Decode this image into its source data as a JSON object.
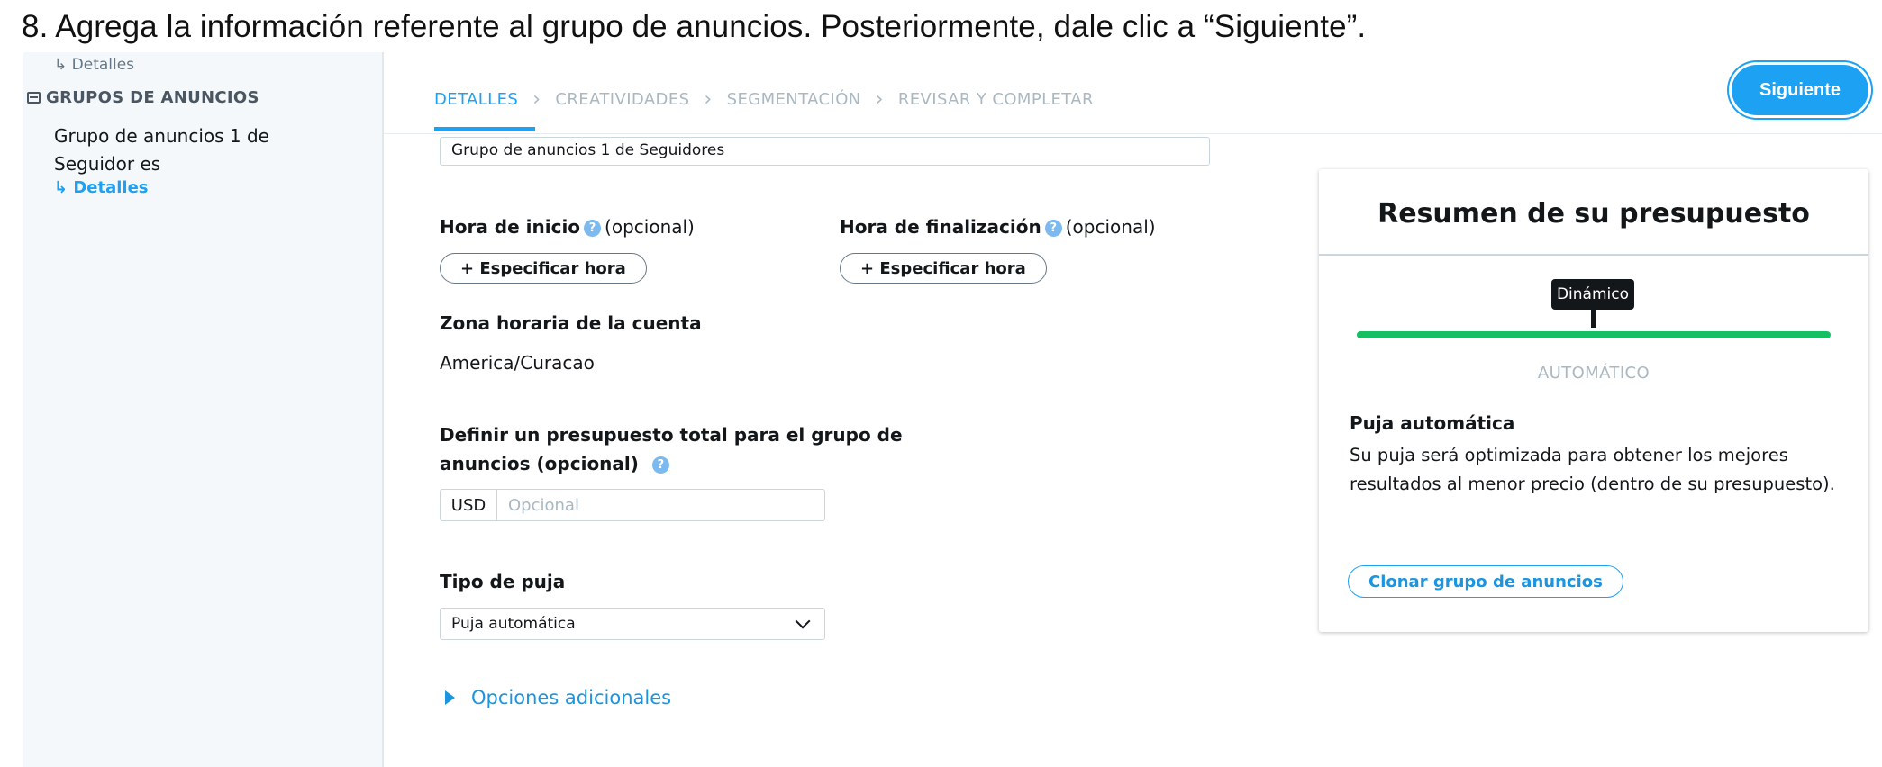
{
  "caption": "8. Agrega la información referente al grupo de anuncios. Posteriormente, dale clic a “Siguiente”.",
  "sidebar": {
    "top_sub": "↳ Detalles",
    "group_label": "GRUPOS DE ANUNCIOS",
    "item_label": "Grupo de anuncios 1 de Seguidor es",
    "active_sub": "↳ Detalles"
  },
  "tabs": [
    {
      "label": "DETALLES",
      "active": true
    },
    {
      "label": "CREATIVIDADES",
      "active": false
    },
    {
      "label": "SEGMENTACIÓN",
      "active": false
    },
    {
      "label": "REVISAR Y COMPLETAR",
      "active": false
    }
  ],
  "tab_separator": ">",
  "next_button": "Siguiente",
  "form": {
    "name_value": "Grupo de anuncios 1 de Seguidores",
    "start": {
      "label": "Hora de inicio",
      "optional": "(opcional)",
      "button": "+ Especificar hora"
    },
    "end": {
      "label": "Hora de finalización",
      "optional": "(opcional)",
      "button": "+ Especificar hora"
    },
    "timezone": {
      "label": "Zona horaria de la cuenta",
      "value": "America/Curacao"
    },
    "budget": {
      "label_line1": "Definir un presupuesto total para el grupo de",
      "label_line2": "anuncios (opcional)",
      "currency": "USD",
      "placeholder": "Opcional"
    },
    "bid": {
      "label": "Tipo de puja",
      "selected": "Puja automática"
    },
    "more_options": "Opciones adicionales"
  },
  "summary": {
    "title": "Resumen de su presupuesto",
    "tooltip": "Dinámico",
    "scale_label": "AUTOMÁTICO",
    "bid_title": "Puja automática",
    "bid_desc": "Su puja será optimizada para obtener los mejores resultados al menor precio (dentro de su presupuesto).",
    "clone_button": "Clonar grupo de anuncios"
  },
  "colors": {
    "accent": "#1da1f2",
    "slider": "#17bf63"
  }
}
